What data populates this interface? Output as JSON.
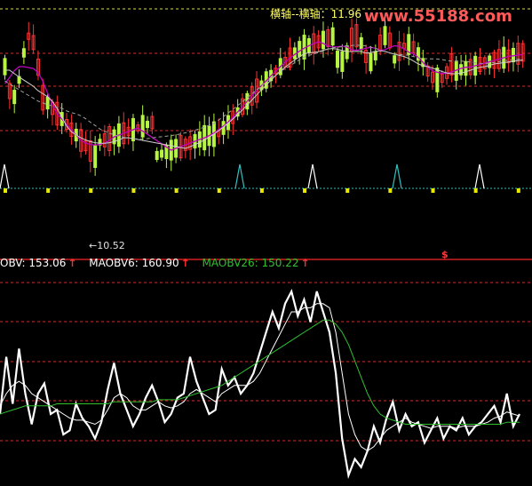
{
  "top_label": "横轴--横轴：11.96",
  "watermark": "www.55188.com",
  "low_note": "←10.52",
  "dollar_mark": "$",
  "colors": {
    "up": "#b7f542",
    "down": "#ff3030",
    "grid": "#c83030",
    "white": "#ffffff",
    "magenta": "#c000c0",
    "green_line": "#30c030",
    "cyan": "#30c0c0",
    "yellow": "#e8e800"
  },
  "legend": {
    "obv_label": "OBV: 153.06",
    "mao6_label": "MAOBV6: 160.90",
    "mao26_label": "MAOBV26: 150.22",
    "arrow": "↑"
  },
  "chart_data": [
    {
      "type": "candlestick",
      "title": "",
      "ylim": [
        10.0,
        12.2
      ],
      "annotations": [
        "11.96",
        "10.52"
      ],
      "signals_up_bars": [
        3,
        54,
        79,
        100
      ],
      "signals_cyan": [
        40,
        64
      ],
      "note": "price pane with white/magenta moving averages"
    },
    {
      "type": "line",
      "series": [
        {
          "name": "OBV",
          "color": "#ffffff",
          "values": [
            30,
            58,
            35,
            62,
            40,
            25,
            40,
            45,
            30,
            32,
            20,
            22,
            35,
            28,
            24,
            18,
            26,
            42,
            55,
            40,
            32,
            24,
            30,
            38,
            44,
            36,
            26,
            30,
            38,
            40,
            58,
            46,
            38,
            30,
            32,
            52,
            44,
            48,
            40,
            44,
            50,
            60,
            70,
            80,
            72,
            84,
            90,
            78,
            86,
            75,
            90,
            80,
            70,
            50,
            18,
            0,
            8,
            4,
            12,
            24,
            16,
            28,
            36,
            22,
            30,
            24,
            26,
            16,
            22,
            28,
            18,
            24,
            22,
            28,
            20,
            24,
            26,
            30,
            34,
            26,
            40,
            24,
            30
          ]
        },
        {
          "name": "MAOBV6",
          "color": "#ffffff",
          "values": [
            34,
            40,
            44,
            46,
            44,
            40,
            38,
            36,
            34,
            32,
            30,
            28,
            27,
            27,
            26,
            25,
            27,
            32,
            38,
            40,
            38,
            34,
            32,
            32,
            34,
            36,
            34,
            33,
            34,
            36,
            40,
            42,
            40,
            38,
            36,
            40,
            42,
            44,
            44,
            44,
            46,
            50,
            56,
            62,
            68,
            74,
            80,
            80,
            82,
            82,
            84,
            84,
            82,
            70,
            50,
            30,
            20,
            14,
            12,
            14,
            18,
            22,
            24,
            26,
            28,
            26,
            25,
            24,
            23,
            24,
            24,
            24,
            23,
            24,
            24,
            24,
            25,
            26,
            28,
            29,
            31,
            30,
            29
          ]
        },
        {
          "name": "MAOBV26",
          "color": "#30c030",
          "values": [
            30,
            31,
            32,
            33,
            34,
            34,
            34,
            34,
            34,
            35,
            35,
            35,
            35,
            35,
            35,
            35,
            35,
            35,
            36,
            36,
            36,
            36,
            36,
            36,
            36,
            37,
            37,
            37,
            37,
            38,
            39,
            40,
            41,
            42,
            43,
            44,
            46,
            48,
            50,
            52,
            54,
            56,
            58,
            60,
            62,
            64,
            66,
            68,
            70,
            72,
            74,
            76,
            76,
            74,
            70,
            64,
            56,
            48,
            40,
            34,
            30,
            28,
            27,
            26,
            25,
            25,
            25,
            25,
            25,
            25,
            25,
            25,
            25,
            25,
            25,
            25,
            25,
            25,
            25,
            25,
            26,
            26,
            26
          ]
        }
      ],
      "ylim": [
        0,
        100
      ]
    }
  ]
}
